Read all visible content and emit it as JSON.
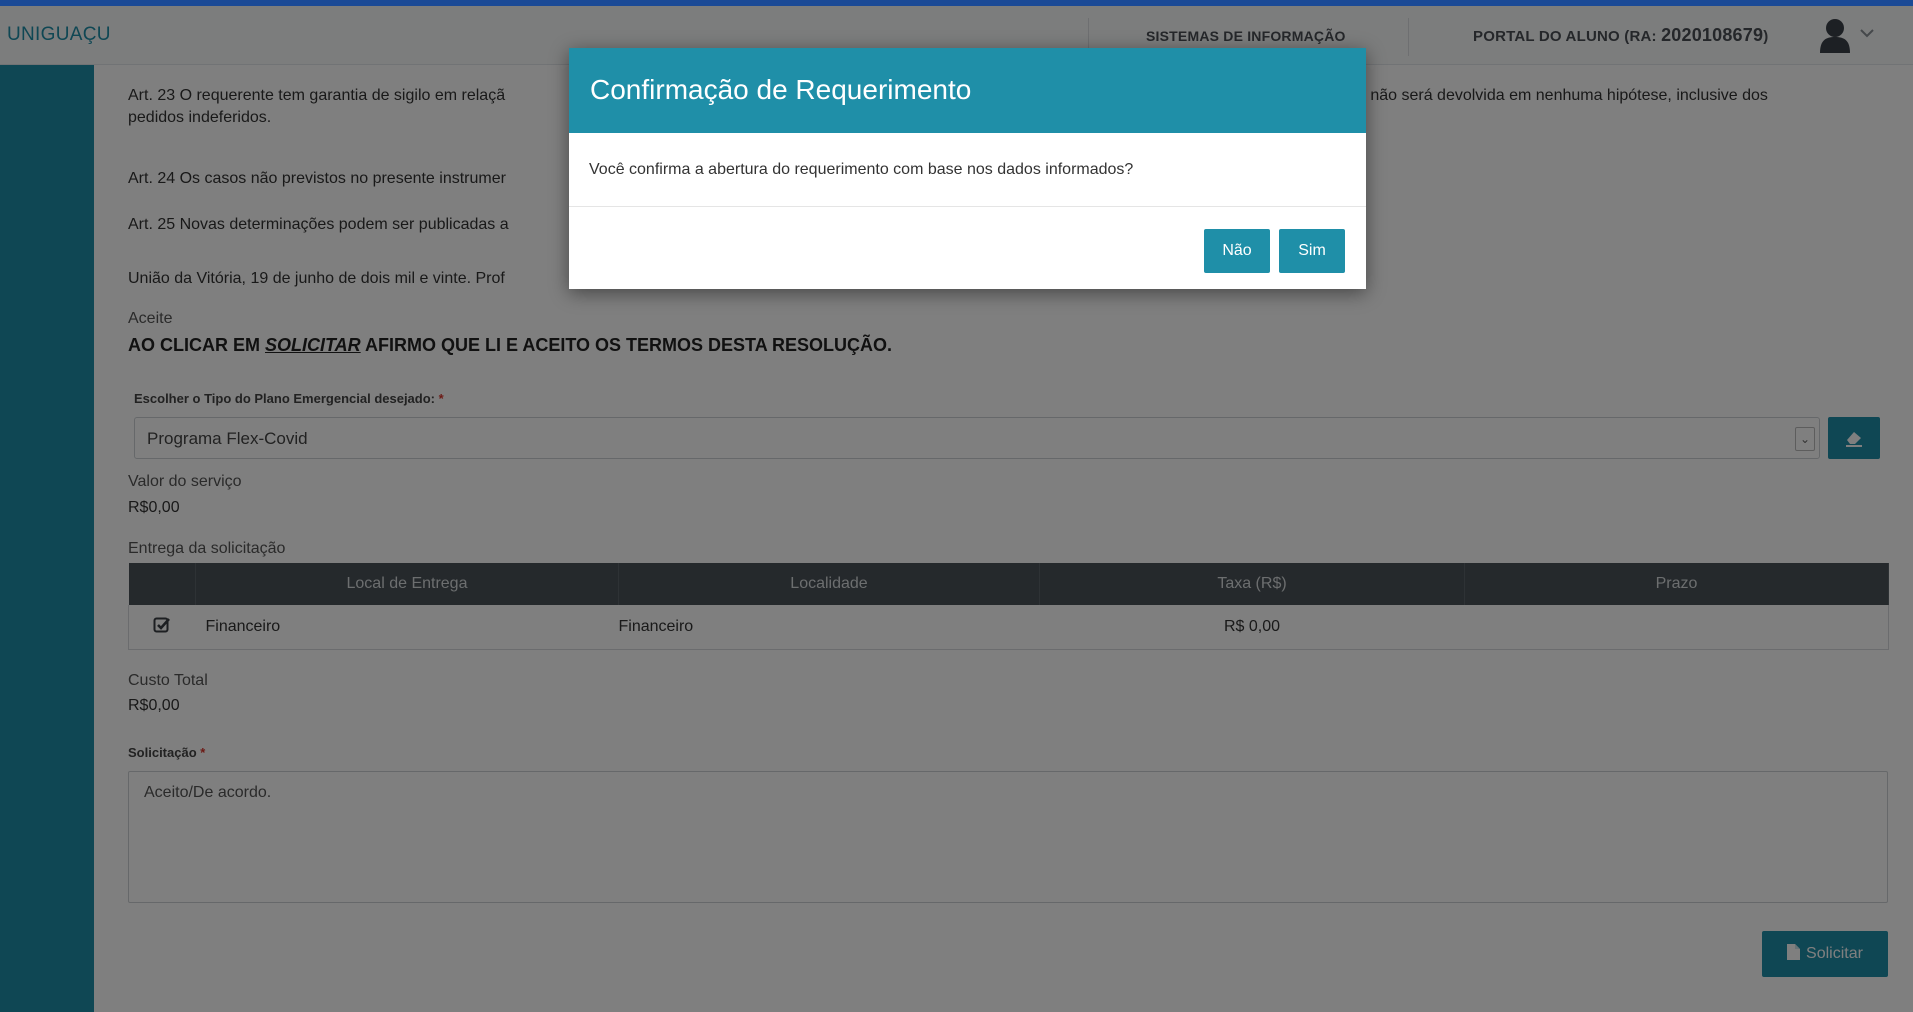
{
  "header": {
    "brand": "UNIGUAÇU",
    "course": "SISTEMAS DE INFORMAÇÃO",
    "portal_prefix": "PORTAL DO ALUNO (RA: ",
    "ra": "2020108679",
    "portal_suffix": ")"
  },
  "document": {
    "art23_visible_start": "Art. 23 O requerente tem garantia de sigilo em relaçã",
    "art23_visible_end": "ue não será devolvida em nenhuma hipótese, inclusive dos",
    "art23_line2": "pedidos indeferidos.",
    "art24": "Art. 24 Os casos não previstos no presente instrumer",
    "art25": "Art. 25 Novas determinações podem ser publicadas a",
    "uniao": "União da Vitória, 19 de junho de dois mil e vinte. Prof",
    "aceite_label": "Aceite",
    "aceite_pre": "AO CLICAR EM ",
    "aceite_em": "SOLICITAR",
    "aceite_post": " AFIRMO QUE LI E ACEITO OS TERMOS DESTA RESOLUÇÃO."
  },
  "form": {
    "plano_label": "Escolher o Tipo do Plano Emergencial desejado:",
    "required_mark": "*",
    "plano_value": "Programa Flex-Covid",
    "valor_label": "Valor do serviço",
    "valor_value": "R$0,00",
    "entrega_label": "Entrega da solicitação",
    "custo_label": "Custo Total",
    "custo_value": "R$0,00",
    "solicitacao_label": "Solicitação",
    "solicitacao_value": "Aceito/De acordo.",
    "solicitar_button": "Solicitar"
  },
  "delivery_table": {
    "columns": [
      "",
      "Local de Entrega",
      "Localidade",
      "Taxa (R$)",
      "Prazo"
    ],
    "rows": [
      {
        "checked": true,
        "local": "Financeiro",
        "localidade": "Financeiro",
        "taxa": "R$ 0,00",
        "prazo": ""
      }
    ]
  },
  "modal": {
    "title": "Confirmação de Requerimento",
    "body": "Você confirma a abertura do requerimento com base nos dados informados?",
    "no_button": "Não",
    "yes_button": "Sim"
  },
  "colors": {
    "accent": "#1f8fa8",
    "table_header": "#4a5258",
    "outer_frame": "#1b4a96"
  }
}
